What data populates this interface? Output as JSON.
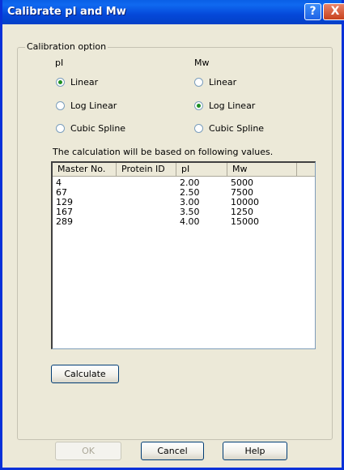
{
  "window": {
    "title": "Calibrate pI and Mw",
    "help_glyph": "?",
    "close_glyph": "X"
  },
  "calibration": {
    "group_label": "Calibration option",
    "pi": {
      "label": "pI",
      "options": [
        "Linear",
        "Log Linear",
        "Cubic Spline"
      ],
      "selected": "Linear"
    },
    "mw": {
      "label": "Mw",
      "options": [
        "Linear",
        "Log Linear",
        "Cubic Spline"
      ],
      "selected": "Log Linear"
    },
    "info_text": "The calculation will be based on following values."
  },
  "table": {
    "columns": [
      "Master No.",
      "Protein ID",
      "pI",
      "Mw"
    ],
    "rows": [
      [
        "4",
        "",
        "2.00",
        "5000"
      ],
      [
        "67",
        "",
        "2.50",
        "7500"
      ],
      [
        "129",
        "",
        "3.00",
        "10000"
      ],
      [
        "167",
        "",
        "3.50",
        "1250"
      ],
      [
        "289",
        "",
        "4.00",
        "15000"
      ]
    ]
  },
  "buttons": {
    "calculate": "Calculate",
    "ok": "OK",
    "cancel": "Cancel",
    "help": "Help"
  }
}
